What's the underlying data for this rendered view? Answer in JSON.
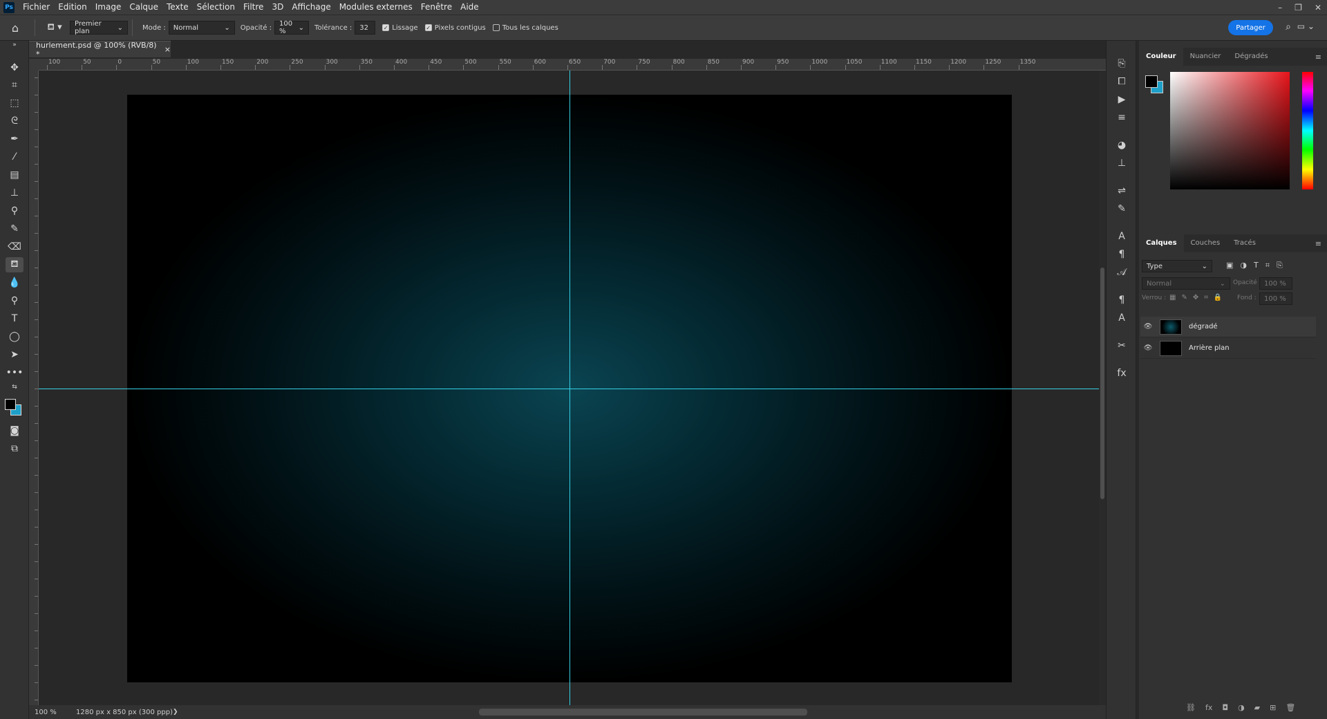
{
  "app": {
    "logo": "Ps",
    "menu": [
      "Fichier",
      "Edition",
      "Image",
      "Calque",
      "Texte",
      "Sélection",
      "Filtre",
      "3D",
      "Affichage",
      "Modules externes",
      "Fenêtre",
      "Aide"
    ],
    "window_controls": [
      "–",
      "❐",
      "✕"
    ]
  },
  "options": {
    "fill_source": "Premier plan",
    "mode_label": "Mode :",
    "mode_value": "Normal",
    "opacity_label": "Opacité :",
    "opacity_value": "100 %",
    "tolerance_label": "Tolérance :",
    "tolerance_value": "32",
    "antialias": "Lissage",
    "contiguous": "Pixels contigus",
    "all_layers": "Tous les calques",
    "share": "Partager"
  },
  "document": {
    "tab_title": "hurlement.psd @ 100% (RVB/8) *",
    "close": "×"
  },
  "ruler_labels": [
    "100",
    "50",
    "0",
    "50",
    "100",
    "150",
    "200",
    "250",
    "300",
    "350",
    "400",
    "450",
    "500",
    "550",
    "600",
    "650",
    "700",
    "750",
    "800",
    "850",
    "900",
    "950",
    "1000",
    "1050",
    "1100",
    "1150",
    "1200",
    "1250",
    "1350"
  ],
  "status": {
    "zoom": "100 %",
    "info": "1280 px x 850 px (300 ppp)",
    "arrow": "❯"
  },
  "color_panel": {
    "tabs": [
      "Couleur",
      "Nuancier",
      "Dégradés"
    ],
    "foreground": "#000000",
    "background": "#1ea0c8"
  },
  "layers_panel": {
    "tabs": [
      "Calques",
      "Couches",
      "Tracés"
    ],
    "filter": "Type",
    "blend": "Normal",
    "opacity_label": "Opacité :",
    "opacity_value": "100 %",
    "lock_label": "Verrou :",
    "fill_label": "Fond :",
    "fill_value": "100 %",
    "layers": [
      {
        "name": "dégradé"
      },
      {
        "name": "Arrière plan"
      }
    ]
  },
  "colors": {
    "guide": "#35d1e6",
    "accent": "#1473e6",
    "glow": "#0a4451"
  }
}
